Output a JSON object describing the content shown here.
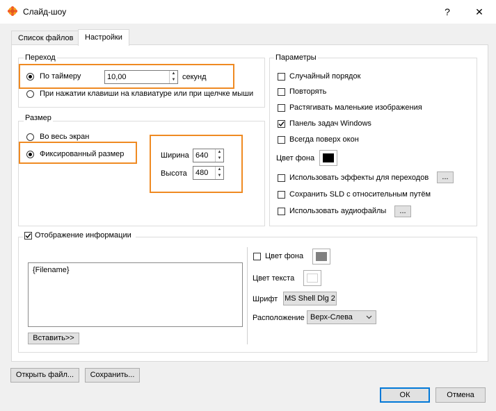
{
  "window": {
    "title": "Слайд-шоу",
    "help_label": "?",
    "close_label": "✕"
  },
  "tabs": [
    {
      "label": "Список файлов",
      "active": false
    },
    {
      "label": "Настройки",
      "active": true
    }
  ],
  "transition": {
    "group_label": "Переход",
    "timer_label": "По таймеру",
    "timer_value": "10,00",
    "timer_unit": "секунд",
    "key_label": "При нажатии клавиши на клавиатуре или при щелчке мыши"
  },
  "size": {
    "group_label": "Размер",
    "fullscreen_label": "Во весь экран",
    "fixed_label": "Фиксированный размер",
    "width_label": "Ширина",
    "width_value": "640",
    "height_label": "Высота",
    "height_value": "480"
  },
  "params": {
    "group_label": "Параметры",
    "random_label": "Случайный порядок",
    "repeat_label": "Повторять",
    "stretch_label": "Растягивать маленькие изображения",
    "taskbar_label": "Панель задач Windows",
    "ontop_label": "Всегда поверх окон",
    "bg_color_label": "Цвет фона",
    "bg_color": "#000000",
    "effects_label": "Использовать эффекты для переходов",
    "save_sld_label": "Сохранить SLD с относительным путём",
    "audio_label": "Использовать аудиофайлы",
    "more_label": "..."
  },
  "info": {
    "group_label": "Отображение информации",
    "text_value": "{Filename}",
    "insert_label": "Вставить>>",
    "bg_color_label": "Цвет фона",
    "bg_color": "#808080",
    "text_color_label": "Цвет текста",
    "text_color": "#ffffff",
    "font_label": "Шрифт",
    "font_value": "MS Shell Dlg 2",
    "position_label": "Расположение",
    "position_value": "Верх-Слева"
  },
  "buttons": {
    "open_label": "Открыть файл...",
    "save_label": "Сохранить...",
    "ok_label": "ОК",
    "cancel_label": "Отмена"
  },
  "colors": {
    "highlight": "#ef8a22",
    "accent": "#0078d7"
  }
}
